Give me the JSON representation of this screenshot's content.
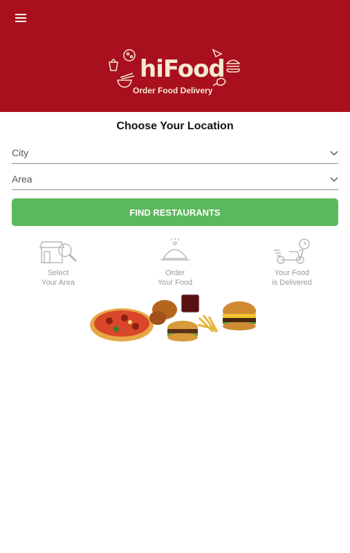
{
  "header": {
    "menu_icon": "hamburger-menu-icon",
    "logo_text": "hiFood",
    "logo_tagline": "Order Food Delivery",
    "color": "#a8101e"
  },
  "main": {
    "title": "Choose Your Location",
    "city_placeholder": "City",
    "area_placeholder": "Area",
    "find_button": "FIND RESTAURANTS",
    "button_color": "#5cb85c"
  },
  "steps": [
    {
      "line1": "Select",
      "line2": "Your Area",
      "icon": "storefront-search-icon"
    },
    {
      "line1": "Order",
      "line2": "Your Food",
      "icon": "food-cloche-icon"
    },
    {
      "line1": "Your Food",
      "line2": "is Delivered",
      "icon": "delivery-scooter-icon"
    }
  ],
  "promo_image": "fast-food-image"
}
